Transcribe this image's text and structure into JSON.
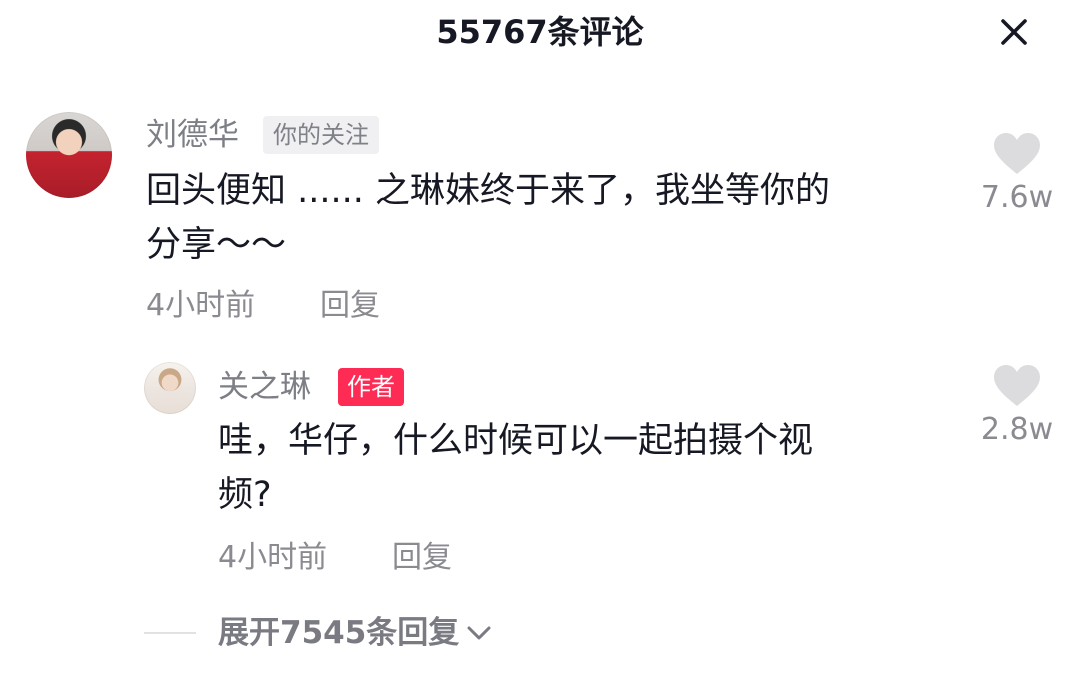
{
  "header": {
    "title": "55767条评论"
  },
  "comments": [
    {
      "username": "刘德华",
      "tag": "你的关注",
      "text": "回头便知 ...... 之琳妹终于来了，我坐等你的\n分享～～",
      "time": "4小时前",
      "reply": "回复",
      "likes": "7.6w",
      "replies": [
        {
          "username": "关之琳",
          "tag": "作者",
          "text": "哇，华仔，什么时候可以一起拍摄个视\n频?",
          "time": "4小时前",
          "reply": "回复",
          "likes": "2.8w"
        }
      ],
      "expand_label": "展开7545条回复"
    }
  ],
  "colors": {
    "author_tag": "#fe2c55",
    "follow_tag_bg": "#f0f0f2",
    "meta_text": "#8a8b91",
    "heart": "#dcdcde"
  },
  "icons": [
    "close-icon",
    "heart-icon",
    "chevron-down-icon"
  ]
}
